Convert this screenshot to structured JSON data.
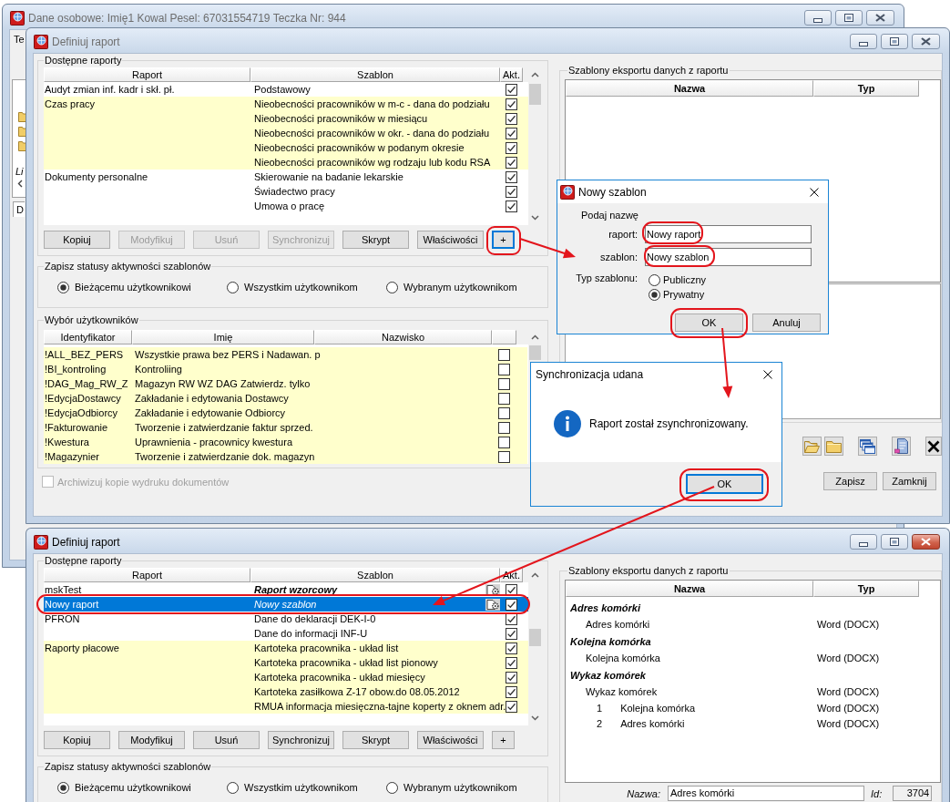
{
  "background_window": {
    "title": "Dane osobowe: Imię1 Kowal Pesel: 67031554719 Teczka Nr: 944",
    "active": false,
    "menu_item": "Te",
    "list_caption": "Li",
    "tab": "D"
  },
  "report_window": {
    "title": "Definiuj raport",
    "active": false,
    "reports": {
      "title": "Dostępne raporty",
      "columns": [
        "Raport",
        "Szablon",
        "Akt."
      ],
      "groups": [
        {
          "report": "Audyt zmian inf. kadr i skł. pł.",
          "shaded": false,
          "templates": [
            {
              "name": "Podstawowy",
              "active": true,
              "selected": false
            }
          ]
        },
        {
          "report": "Czas pracy",
          "shaded": true,
          "templates": [
            {
              "name": "Nieobecności pracowników w m-c - dana do podziału",
              "active": true,
              "selected": false
            },
            {
              "name": "Nieobecności pracowników w miesiącu",
              "active": true,
              "selected": false
            },
            {
              "name": "Nieobecności pracowników w okr. - dana do podziału",
              "active": true,
              "selected": false
            },
            {
              "name": "Nieobecności pracowników w podanym okresie",
              "active": true,
              "selected": false
            },
            {
              "name": "Nieobecności pracowników wg rodzaju lub kodu RSA",
              "active": true,
              "selected": false
            }
          ]
        },
        {
          "report": "Dokumenty personalne",
          "shaded": false,
          "templates": [
            {
              "name": "Skierowanie na badanie lekarskie",
              "active": true,
              "selected": false
            },
            {
              "name": "Świadectwo pracy",
              "active": true,
              "selected": false
            },
            {
              "name": "Umowa o pracę",
              "active": true,
              "selected": false
            }
          ]
        }
      ]
    },
    "buttons": [
      {
        "label": "Kopiuj",
        "disabled": false,
        "focused": false
      },
      {
        "label": "Modyfikuj",
        "disabled": true,
        "focused": false
      },
      {
        "label": "Usuń",
        "disabled": true,
        "focused": false
      },
      {
        "label": "Synchronizuj",
        "disabled": true,
        "focused": false
      },
      {
        "label": "Skrypt",
        "disabled": false,
        "focused": false
      },
      {
        "label": "Właściwości",
        "disabled": false,
        "focused": false
      },
      {
        "label": "+",
        "disabled": false,
        "focused": true
      }
    ],
    "status_scope": {
      "title": "Zapisz statusy aktywności szablonów",
      "options": [
        {
          "label": "Bieżącemu użytkownikowi",
          "selected": true
        },
        {
          "label": "Wszystkim użytkownikom",
          "selected": false
        },
        {
          "label": "Wybranym użytkownikom",
          "selected": false
        }
      ]
    },
    "users": {
      "title": "Wybór użytkowników",
      "columns": [
        "Identyfikator",
        "Imię",
        "Nazwisko"
      ],
      "rows": [
        {
          "id": "!ALL_BEZ_PERS",
          "first_name": "Wszystkie prawa bez PERS i Nadawan. p",
          "checked": false
        },
        {
          "id": "!BI_kontroling",
          "first_name": "Kontroliing",
          "checked": false
        },
        {
          "id": "!DAG_Mag_RW_Z",
          "first_name": "Magazyn RW WZ DAG Zatwierdz. tylko",
          "checked": false
        },
        {
          "id": "!EdycjaDostawcy",
          "first_name": "Zakładanie i edytowania Dostawcy",
          "checked": false
        },
        {
          "id": "!EdycjaOdbiorcy",
          "first_name": "Zakładanie i edytowanie Odbiorcy",
          "checked": false
        },
        {
          "id": "!Fakturowanie",
          "first_name": "Tworzenie i zatwierdzanie faktur sprzed.",
          "checked": false
        },
        {
          "id": "!Kwestura",
          "first_name": "Uprawnienia - pracownicy kwestura",
          "checked": false
        },
        {
          "id": "!Magazynier",
          "first_name": "Tworzenie i zatwierdzanie dok. magazyn",
          "checked": false
        }
      ]
    },
    "archive_copies": {
      "label": "Archiwizuj kopie wydruku dokumentów",
      "checked": false,
      "disabled": true
    },
    "export_templates": {
      "title": "Szablony eksportu danych z raportu",
      "columns": [
        "Nazwa",
        "Typ"
      ]
    },
    "footer_buttons": [
      "Zapisz",
      "Zamknij"
    ]
  },
  "new_template_dialog": {
    "title": "Nowy szablon",
    "prompt": "Podaj nazwę",
    "fields": [
      {
        "label": "raport:",
        "value": "Nowy raport"
      },
      {
        "label": "szablon:",
        "value": "Nowy szablon"
      }
    ],
    "type_label": "Typ szablonu:",
    "types": [
      {
        "label": "Publiczny",
        "selected": false
      },
      {
        "label": "Prywatny",
        "selected": true
      }
    ],
    "buttons": [
      "OK",
      "Anuluj"
    ]
  },
  "sync_dialog": {
    "title": "Synchronizacja udana",
    "message": "Raport został zsynchronizowany.",
    "buttons": [
      {
        "label": "OK",
        "focused": true
      }
    ]
  },
  "result_window": {
    "title": "Definiuj raport",
    "active": true,
    "reports": {
      "title": "Dostępne raporty",
      "columns": [
        "Raport",
        "Szablon",
        "Akt."
      ],
      "groups": [
        {
          "report": "mskTest",
          "shaded": false,
          "templates": [
            {
              "name": "Raport wzorcowy",
              "kind": "model",
              "active": true,
              "selected": false
            }
          ]
        },
        {
          "report": "Nowy raport",
          "templates": [
            {
              "name": "Nowy szablon",
              "kind": "user",
              "active": true,
              "selected": true
            }
          ]
        },
        {
          "report": "PFRON",
          "shaded": false,
          "templates": [
            {
              "name": "Dane do deklaracji DEK-I-0",
              "kind": "standard",
              "active": true,
              "selected": false
            },
            {
              "name": "Dane do informacji INF-U",
              "kind": "standard",
              "active": true,
              "selected": false
            }
          ]
        },
        {
          "report": "Raporty płacowe",
          "shaded": true,
          "templates": [
            {
              "name": "Kartoteka pracownika - układ list",
              "kind": "standard",
              "active": true,
              "selected": false
            },
            {
              "name": "Kartoteka pracownika - układ list pionowy",
              "kind": "standard",
              "active": true,
              "selected": false
            },
            {
              "name": "Kartoteka pracownika - układ miesięcy",
              "kind": "standard",
              "active": true,
              "selected": false
            },
            {
              "name": "Kartoteka zasiłkowa Z-17 obow.do 08.05.2012",
              "kind": "standard",
              "active": true,
              "selected": false
            },
            {
              "name": "RMUA informacja miesięczna-tajne koperty z oknem adr.",
              "kind": "standard",
              "active": true,
              "selected": false
            }
          ]
        }
      ]
    },
    "buttons": [
      {
        "label": "Kopiuj",
        "disabled": false,
        "focused": false
      },
      {
        "label": "Modyfikuj",
        "disabled": false,
        "focused": false
      },
      {
        "label": "Usuń",
        "disabled": false,
        "focused": false
      },
      {
        "label": "Synchronizuj",
        "disabled": false,
        "focused": false
      },
      {
        "label": "Skrypt",
        "disabled": false,
        "focused": false
      },
      {
        "label": "Właściwości",
        "disabled": false,
        "focused": false
      },
      {
        "label": "+",
        "disabled": false,
        "focused": false
      }
    ],
    "status_scope": {
      "title": "Zapisz statusy aktywności szablonów",
      "options": [
        {
          "label": "Bieżącemu użytkownikowi",
          "selected": true
        },
        {
          "label": "Wszystkim użytkownikom",
          "selected": false
        },
        {
          "label": "Wybranym użytkownikom",
          "selected": false
        }
      ]
    },
    "export_templates": {
      "title": "Szablony eksportu danych z raportu",
      "columns": [
        "Nazwa",
        "Typ"
      ],
      "tree": [
        {
          "name": "Adres komórki",
          "children": [
            {
              "name": "Adres komórki",
              "type": "Word (DOCX)"
            }
          ]
        },
        {
          "name": "Kolejna komórka",
          "children": [
            {
              "name": "Kolejna komórka",
              "type": "Word (DOCX)"
            }
          ]
        },
        {
          "name": "Wykaz komórek",
          "children": [
            {
              "name": "Wykaz komórek",
              "type": "Word (DOCX)",
              "children": [
                {
                  "number": "1",
                  "name": "Kolejna komórka",
                  "type": "Word (DOCX)"
                },
                {
                  "number": "2",
                  "name": "Adres komórki",
                  "type": "Word (DOCX)"
                }
              ]
            }
          ]
        }
      ],
      "name_field": {
        "label": "Nazwa:",
        "value": "Adres komórki"
      },
      "id_field": {
        "label": "Id:",
        "value": "3704"
      }
    }
  }
}
